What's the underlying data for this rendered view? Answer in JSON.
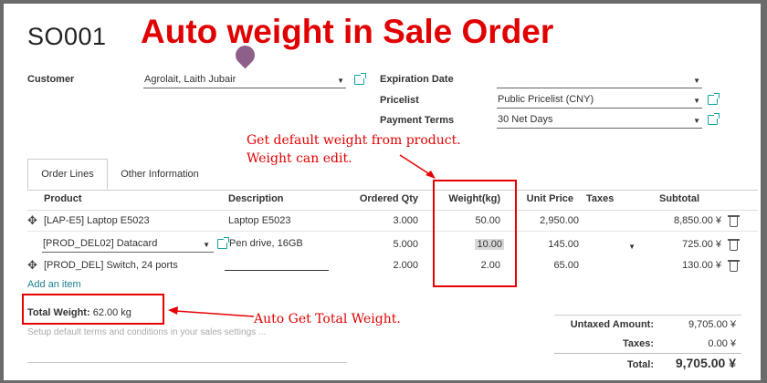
{
  "order": {
    "number": "SO001"
  },
  "banner": {
    "text": "Auto weight in Sale Order"
  },
  "customer": {
    "label": "Customer",
    "value": "Agrolait, Laith Jubair"
  },
  "expiration": {
    "label": "Expiration Date",
    "value": ""
  },
  "pricelist": {
    "label": "Pricelist",
    "value": "Public Pricelist (CNY)"
  },
  "payment_terms": {
    "label": "Payment Terms",
    "value": "30 Net Days"
  },
  "annotations": {
    "weight_line1": "Get default weight from product.",
    "weight_line2": "Weight can edit.",
    "total": "Auto Get Total Weight."
  },
  "tabs": [
    {
      "label": "Order Lines"
    },
    {
      "label": "Other Information"
    }
  ],
  "table": {
    "headers": {
      "product": "Product",
      "description": "Description",
      "ordered_qty": "Ordered Qty",
      "weight": "Weight(kg)",
      "unit_price": "Unit Price",
      "taxes": "Taxes",
      "subtotal": "Subtotal"
    },
    "rows": [
      {
        "product": "[LAP-E5] Laptop E5023",
        "description": "Laptop E5023",
        "qty": "3.000",
        "weight": "50.00",
        "unit_price": "2,950.00",
        "taxes": "",
        "subtotal": "8,850.00 ¥"
      },
      {
        "product": "[PROD_DEL02] Datacard",
        "description": "Pen drive, 16GB",
        "qty": "5.000",
        "weight": "10.00",
        "unit_price": "145.00",
        "taxes": "",
        "subtotal": "725.00 ¥"
      },
      {
        "product": "[PROD_DEL] Switch, 24 ports",
        "description": "",
        "qty": "2.000",
        "weight": "2.00",
        "unit_price": "65.00",
        "taxes": "",
        "subtotal": "130.00 ¥"
      }
    ],
    "add_item": "Add an item"
  },
  "total_weight": {
    "label": "Total Weight:",
    "value": "62.00 kg"
  },
  "terms_placeholder": "Setup default terms and conditions in your sales settings ...",
  "totals": {
    "untaxed_label": "Untaxed Amount:",
    "untaxed_value": "9,705.00 ¥",
    "taxes_label": "Taxes:",
    "taxes_value": "0.00 ¥",
    "total_label": "Total:",
    "total_value": "9,705.00 ¥"
  },
  "colors": {
    "annotation_red": "#e10000",
    "link_teal": "#17a2a2"
  }
}
